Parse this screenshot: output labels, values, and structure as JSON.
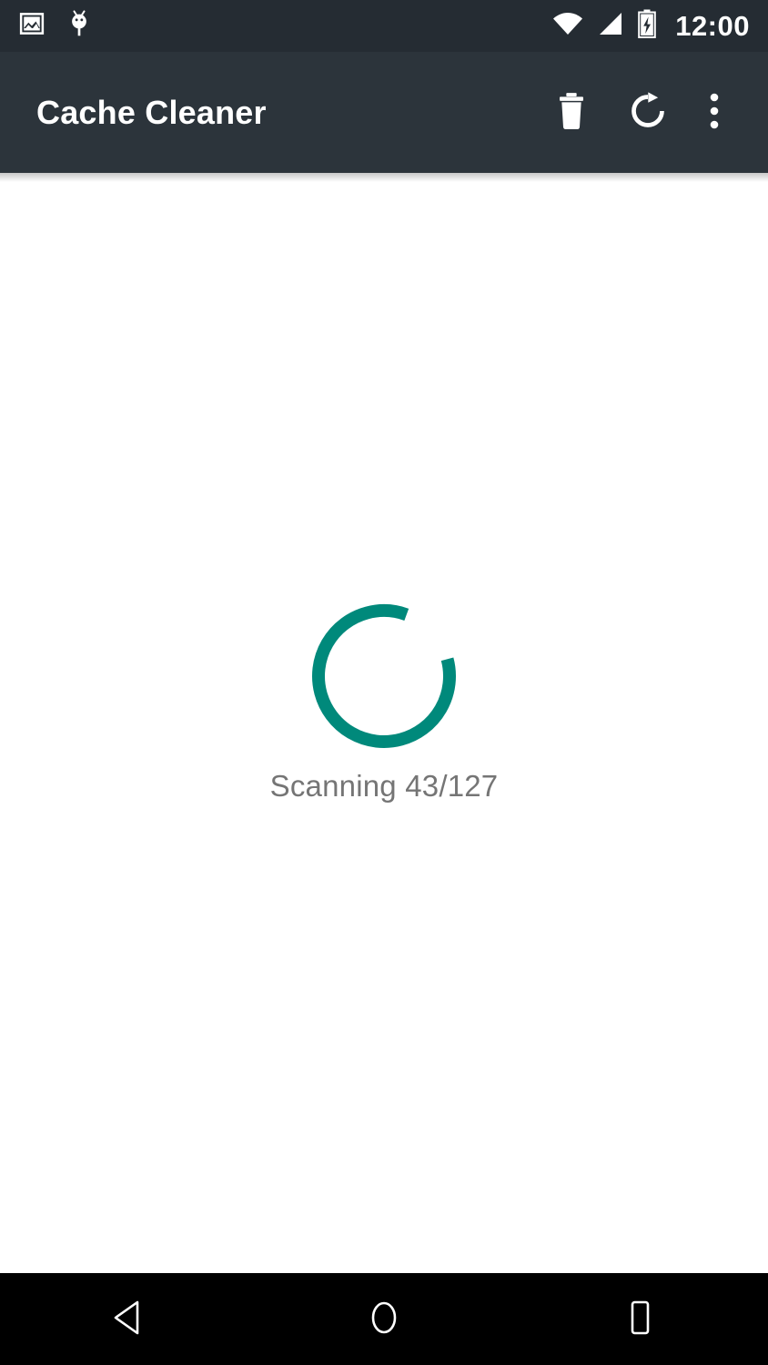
{
  "status_bar": {
    "background": "#252c33",
    "clock": "12:00",
    "left_icons": [
      {
        "name": "screenshot-image-icon",
        "label": "Screenshot"
      },
      {
        "name": "android-debug-icon",
        "label": "USB debugging"
      }
    ],
    "right_icons": [
      {
        "name": "wifi-icon",
        "label": "Wi-Fi full signal"
      },
      {
        "name": "cellular-signal-icon",
        "label": "Cellular signal"
      },
      {
        "name": "battery-charging-icon",
        "label": "Battery charging"
      }
    ]
  },
  "app_bar": {
    "background": "#2c343b",
    "title": "Cache Cleaner",
    "actions": [
      {
        "name": "delete-button",
        "icon": "trash-icon",
        "label": "Clear cache"
      },
      {
        "name": "refresh-button",
        "icon": "refresh-icon",
        "label": "Rescan"
      },
      {
        "name": "overflow-menu-button",
        "icon": "more-vert-icon",
        "label": "More options"
      }
    ]
  },
  "content": {
    "background": "#ffffff",
    "progress": {
      "accent_color": "#00897b",
      "indeterminate": true,
      "label": "Scanning 43/127",
      "label_color": "#757575",
      "current": 43,
      "total": 127,
      "arc_start_deg": 75,
      "arc_sweep_deg": 305,
      "stroke_width": 14
    }
  },
  "nav_bar": {
    "background": "#000000",
    "buttons": [
      {
        "name": "nav-back-button",
        "icon": "back-triangle-icon",
        "label": "Back"
      },
      {
        "name": "nav-home-button",
        "icon": "home-circle-icon",
        "label": "Home"
      },
      {
        "name": "nav-recents-button",
        "icon": "recents-square-icon",
        "label": "Recents"
      }
    ]
  }
}
